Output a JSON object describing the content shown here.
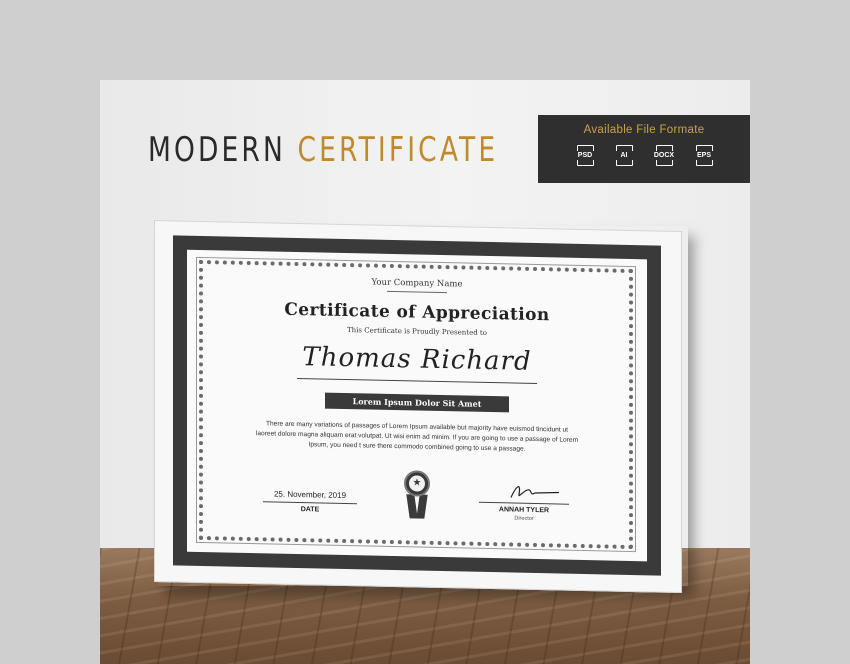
{
  "heading": {
    "word1": "MODERN",
    "word2": "CERTIFICATE"
  },
  "formats": {
    "title": "Available File Formate",
    "items": [
      {
        "label": "PSD",
        "icon": "file-icon"
      },
      {
        "label": "AI",
        "icon": "file-icon"
      },
      {
        "label": "DOCX",
        "icon": "file-icon"
      },
      {
        "label": "EPS",
        "icon": "file-icon"
      }
    ]
  },
  "certificate": {
    "company": "Your Company Name",
    "title": "Certificate of Appreciation",
    "presented": "This Certificate is Proudly Presented to",
    "recipient": "Thomas Richard",
    "banner": "Lorem Ipsum Dolor Sit Amet",
    "body_lines": [
      "There are many variations of passages of Lorem Ipsum available but majority have  euismod tincidunt ut",
      "laoreet dolore magna aliquam erat volutpat. Ut wisi enim ad minim. If you are going to use a passage of Lorem",
      "Ipsum, you need t sure there commodo  combined going to use a passage."
    ],
    "date_value": "25. November, 2019",
    "date_label": "DATE",
    "signer_name": "ANNAH TYLER",
    "signer_role": "Director"
  },
  "colors": {
    "accent": "#c08a2b",
    "dark": "#2f2f2f",
    "frame": "#3a3a3a"
  }
}
